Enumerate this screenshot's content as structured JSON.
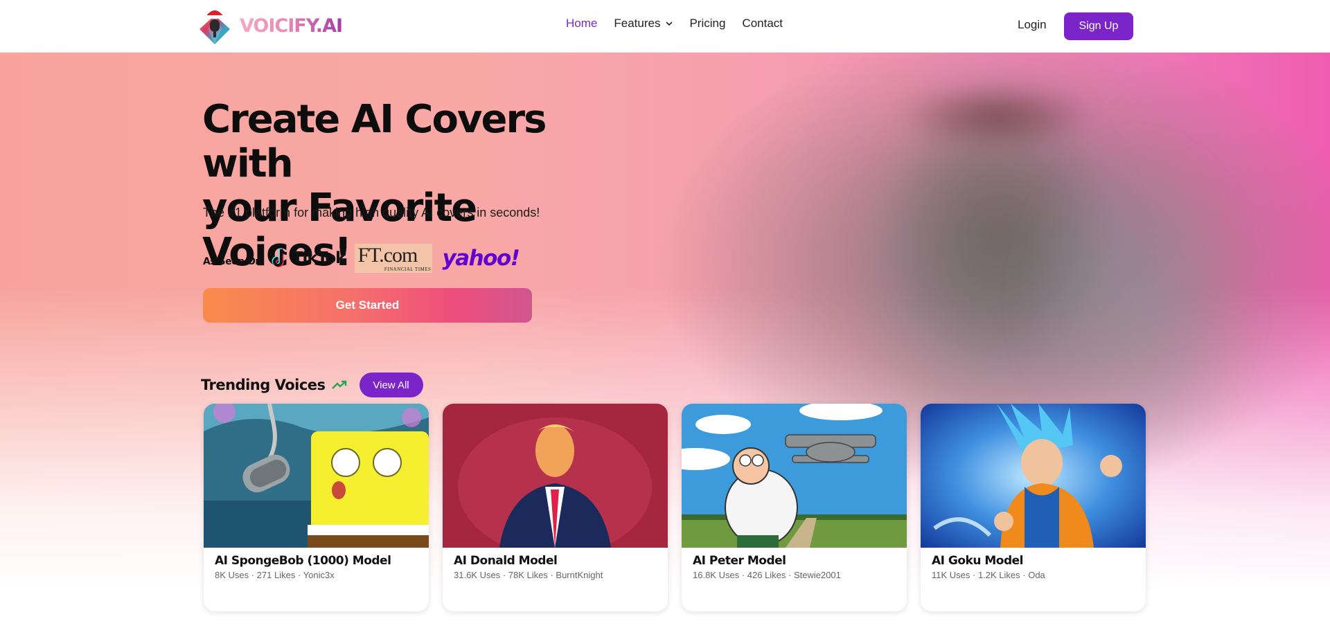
{
  "header": {
    "brand": "VOICIFY.AI",
    "nav": [
      {
        "label": "Home",
        "active": true
      },
      {
        "label": "Features"
      },
      {
        "label": "Pricing"
      },
      {
        "label": "Contact"
      }
    ],
    "login": "Login",
    "signup": "Sign Up"
  },
  "hero": {
    "headline_line1": "Create AI Covers with",
    "headline_line2": "your Favorite Voices!",
    "subtitle": "The #1 platform for making high quality AI covers in seconds!",
    "seen_on_label": "As Seen On",
    "press": {
      "tiktok": "TikTok",
      "ft": ".com",
      "ft_prefix": "FT",
      "ft_sub": "FINANCIAL TIMES",
      "yahoo": "yahoo!"
    },
    "cta": "Get Started"
  },
  "trending": {
    "title": "Trending Voices",
    "view_all": "View All",
    "cards": [
      {
        "title": "AI SpongeBob (1000) Model",
        "meta": "8K Uses · 271 Likes · Yonic3x",
        "theme": "spongebob"
      },
      {
        "title": "AI Donald Model",
        "meta": "31.6K Uses · 78K Likes · BurntKnight",
        "theme": "donald"
      },
      {
        "title": "AI Peter Model",
        "meta": "16.8K Uses · 426 Likes · Stewie2001",
        "theme": "peter"
      },
      {
        "title": "AI Goku Model",
        "meta": "11K Uses · 1.2K Likes · Oda",
        "theme": "goku"
      }
    ]
  },
  "colors": {
    "accent": "#7b24c9",
    "nav_active": "#7b2cbf",
    "cta_start": "#f98b4c",
    "cta_end": "#d0568f",
    "yahoo": "#6001d2",
    "trend_icon": "#22a652"
  },
  "icons": [
    "microphone-logo-icon",
    "chevron-down-icon",
    "tiktok-logo-icon",
    "trending-up-icon"
  ]
}
